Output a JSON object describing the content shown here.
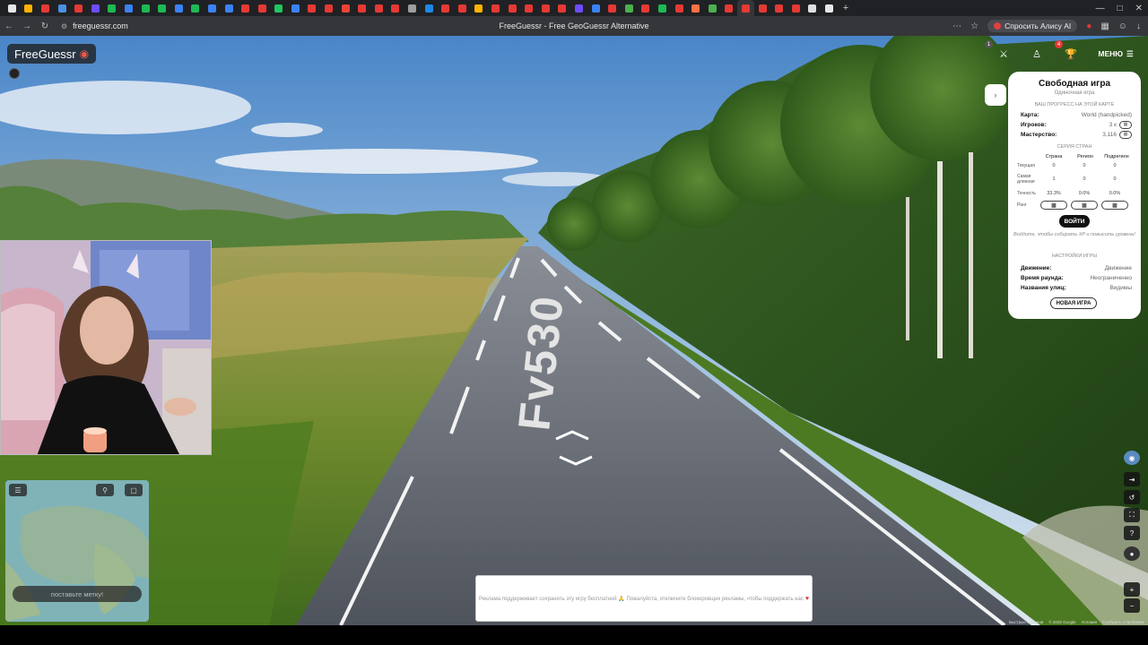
{
  "browser": {
    "url": "freeguessr.com",
    "page_title": "FreeGuessr - Free GeoGuessr Alternative",
    "alice_label": "Спросить Алису AI",
    "tab_colors": [
      "#e8e8e8",
      "#ffb300",
      "#e53935",
      "#4a90e2",
      "#e53935",
      "#6d4cff",
      "#1db954",
      "#3b82f6",
      "#1db954",
      "#1db954",
      "#3b82f6",
      "#1db954",
      "#3b82f6",
      "#3b82f6",
      "#e53935",
      "#e53935",
      "#22c55e",
      "#3b82f6",
      "#e53935",
      "#e53935",
      "#ea4335",
      "#e53935",
      "#e53935",
      "#e53935",
      "#9e9e9e",
      "#1e88e5",
      "#e53935",
      "#e53935",
      "#ffb300",
      "#e53935",
      "#e53935",
      "#e53935",
      "#e53935",
      "#e53935",
      "#6d4cff",
      "#3b82f6",
      "#e53935",
      "#4caf50",
      "#e53935",
      "#1db954",
      "#e53935",
      "#ff7043",
      "#4caf50",
      "#e53935",
      "#e53935",
      "#e53935",
      "#e53935",
      "#e53935",
      "#e0e0e0",
      "#e8e8e8"
    ]
  },
  "logo": {
    "text": "FreeGuessr"
  },
  "minimap": {
    "guess_label": "поставьте метку!"
  },
  "topbar": {
    "menu_label": "МЕНЮ",
    "badge_left": "1",
    "badge_right": "4"
  },
  "panel": {
    "title": "Свободная игра",
    "subtitle": "Одиночная игра",
    "progress_section": "ВАШ ПРОГРЕСС НА ЭТОЙ КАРТЕ",
    "rows": [
      {
        "key": "Карта:",
        "value": "World (handpicked)"
      },
      {
        "key": "Игроков:",
        "value": "3 к"
      },
      {
        "key": "Мастерство:",
        "value": "3,116"
      }
    ],
    "streak_section": "СЕРИЯ СТРАН",
    "columns": [
      "Страна",
      "Регион",
      "Подрегион"
    ],
    "streak_rows": [
      {
        "label": "Текущая",
        "cells": [
          "0",
          "0",
          "0"
        ]
      },
      {
        "label": "Самая длинная",
        "cells": [
          "1",
          "0",
          "0"
        ]
      },
      {
        "label": "Точность",
        "cells": [
          "33.3%",
          "0.0%",
          "0.0%"
        ]
      },
      {
        "label": "Ранг",
        "cells": [
          "",
          "",
          ""
        ]
      }
    ],
    "login_label": "ВОЙТИ",
    "login_note": "Войдите, чтобы собирать XP и повысить уровень!",
    "settings_section": "НАСТРОЙКИ ИГРЫ",
    "settings": [
      {
        "key": "Движение:",
        "value": "Движение"
      },
      {
        "key": "Время раунда:",
        "value": "Неограниченно"
      },
      {
        "key": "Названия улиц:",
        "value": "Видимы"
      }
    ],
    "newgame_label": "НОВАЯ ИГРА"
  },
  "scene": {
    "road_marking": "Fv530"
  },
  "ad": {
    "text": "Реклама поддерживает сохранять эту игру бесплатной 🙏 Пожалуйста, отключите блокировщик рекламы, чтобы поддержать нас"
  },
  "credits": [
    "Быстрые клавиши",
    "© 2025 Google",
    "Условия",
    "Сообщить о проблеме"
  ]
}
